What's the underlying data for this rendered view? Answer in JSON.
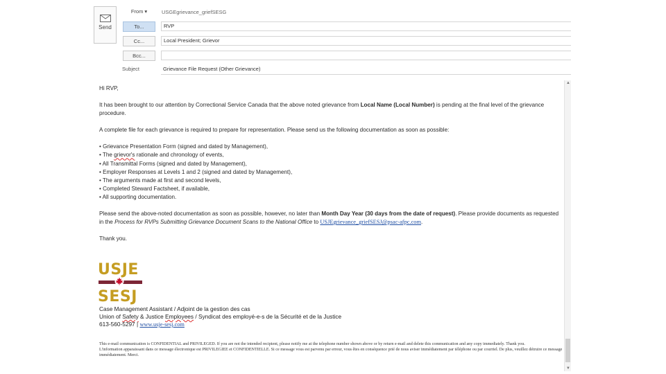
{
  "header": {
    "send_label": "Send",
    "from_label": "From ▾",
    "from_value": "USGEgrievance_griefSESG",
    "to_label": "To...",
    "to_value": "RVP",
    "cc_label": "Cc...",
    "cc_value": "Local President; Grievor",
    "bcc_label": "Bcc...",
    "bcc_value": "",
    "subject_label": "Subject",
    "subject_value": "Grievance File Request (Other Grievance)"
  },
  "body": {
    "greeting": "Hi RVP,",
    "para1_a": "It has been brought to our attention by Correctional Service Canada that the above noted grievance from ",
    "para1_bold1": "Local Name (Local Number)",
    "para1_b": " is pending at the final level of the grievance procedure.",
    "para2": "A complete file for each grievance is required to prepare for representation.  Please send us the following documentation as soon as possible:",
    "bullets": [
      "• Grievance Presentation Form (signed and dated by Management),",
      "• All Transmittal Forms (signed and dated by Management),",
      "• Employer Responses at Levels 1 and 2 (signed and dated by Management),",
      "• The arguments made at first and second levels,",
      "• Completed Steward Factsheet, if available,",
      "• All supporting documentation."
    ],
    "bullet2_a": "• The ",
    "bullet2_spell": "grievor's",
    "bullet2_b": " rationale and chronology of events,",
    "para3_a": "Please send the above-noted documentation as soon as possible, however, no later than ",
    "para3_bold": "Month Day Year (30 days from the date of request)",
    "para3_b": ". Please provide documents as requested in the ",
    "para3_ital": "Process for RVPs Submitting Grievance Document Scans to the National Office",
    "para3_c": " to ",
    "para3_link": "USJEgrievance_griefSESJ@psac-afpc.com",
    "para3_d": ".",
    "thanks": "Thank you."
  },
  "logo": {
    "top": "USJE",
    "bottom": "SESJ",
    "bar_color": "#7c2636",
    "text_color": "#c59d22",
    "leaf_color": "#c8102e"
  },
  "signature": {
    "title": "Case Management Assistant / Adjoint de la gestion des cas",
    "org_a": "Union of ",
    "org_spell1": "Safety",
    "org_b": " & Justice ",
    "org_spell2": "Employees",
    "org_c": " / Syndicat des employé-e-s de la Sécurité et de la Justice",
    "phone": "613-560-5297",
    "separator": " | ",
    "url": "www.usje-sesj.com"
  },
  "disclaimer": {
    "en": "This e-mail communication is CONFIDENTIAL and PRIVILEGED. If you are not the intended recipient, please notify me at the telephone number shown above or by return e-mail and delete this communication and any copy immediately. Thank you.",
    "fr": "L'information apparaissant dans ce message électronique est PRIVILEGIEE et CONFIDENTIELLE. Si ce message vous est parvenu par erreur, vous êtes en conséquence prié de nous aviser immédiatement par téléphone ou par courriel. De plus, veuillez détruire ce message immédiatement. Merci."
  },
  "colors": {
    "accent_to": "#cfe0f3",
    "link": "#1f4ea3"
  }
}
